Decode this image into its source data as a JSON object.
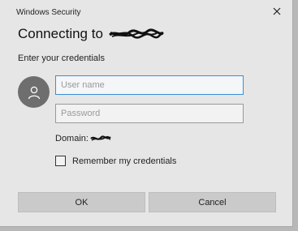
{
  "window": {
    "title": "Windows Security"
  },
  "dialog": {
    "heading": "Connecting to",
    "subheading": "Enter your credentials",
    "username_placeholder": "User name",
    "password_placeholder": "Password",
    "domain_label": "Domain:",
    "remember_label": "Remember my credentials",
    "remember_checked": false,
    "ok_label": "OK",
    "cancel_label": "Cancel"
  },
  "icons": {
    "close": "close-icon",
    "avatar": "user-icon",
    "redaction": "redaction-scribble"
  },
  "colors": {
    "dialog_bg": "#e6e6e6",
    "focus_border": "#3a8fd6",
    "avatar_bg": "#6e6e6e",
    "button_bg": "#cacaca"
  }
}
